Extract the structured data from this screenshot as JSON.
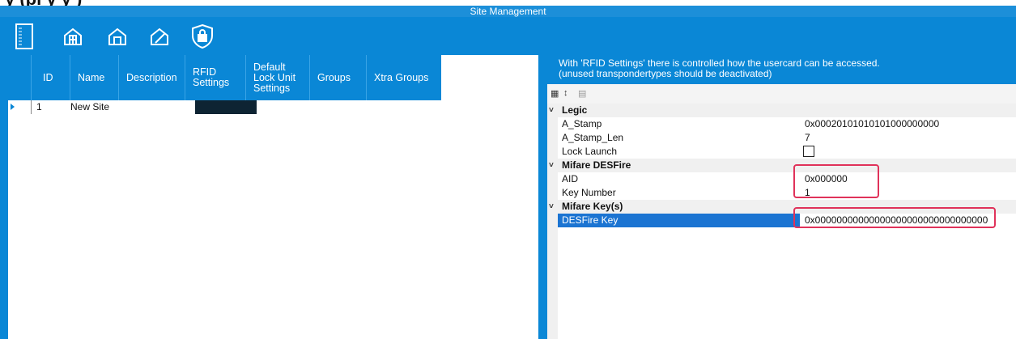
{
  "top_clipped_text": "y (pl y y )",
  "window_title": "Site Management",
  "toolbar": {
    "icons": [
      "document-icon",
      "building-icon",
      "house-icon",
      "house-edit-icon",
      "shield-lock-icon"
    ]
  },
  "grid": {
    "columns": [
      "ID",
      "Name",
      "Description",
      "RFID Settings",
      "Default Lock Unit Settings",
      "Groups",
      "Xtra Groups"
    ],
    "rows": [
      {
        "id": "1",
        "name": "New Site"
      }
    ]
  },
  "panel": {
    "description_line1": "With 'RFID Settings' there is controlled how the usercard can be accessed.",
    "description_line2": "(unused transpondertypes should be deactivated)",
    "categories": [
      {
        "name": "Legic",
        "props": [
          {
            "name": "A_Stamp",
            "value": "0x00020101010101000000000"
          },
          {
            "name": "A_Stamp_Len",
            "value": "7"
          },
          {
            "name": "Lock Launch",
            "value": ""
          }
        ]
      },
      {
        "name": "Mifare DESFire",
        "props": [
          {
            "name": "AID",
            "value": "0x000000"
          },
          {
            "name": "Key Number",
            "value": "1"
          }
        ]
      },
      {
        "name": "Mifare Key(s)",
        "props": [
          {
            "name": "DESFire Key",
            "value": "0x00000000000000000000000000000000"
          }
        ]
      }
    ]
  },
  "colors": {
    "accent": "#0a87d6",
    "selection": "#1b74d2",
    "highlight": "#e0325a"
  }
}
